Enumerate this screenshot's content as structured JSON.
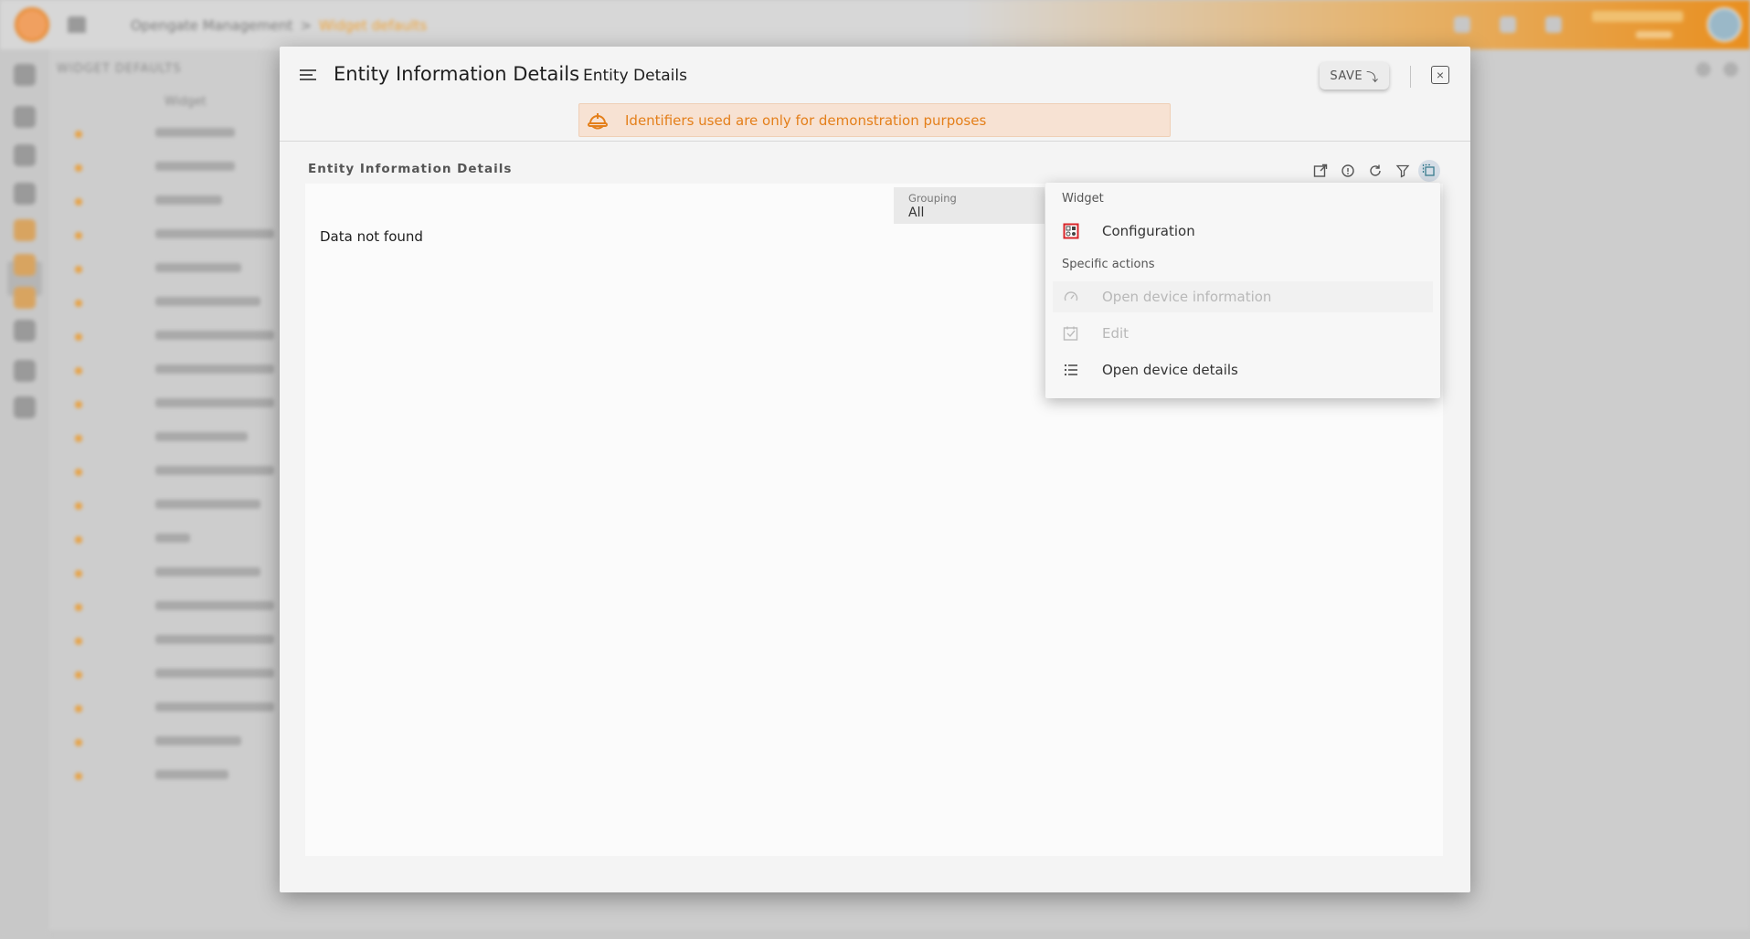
{
  "app": {
    "breadcrumb": {
      "parent": "Opengate Management",
      "separator": ">",
      "current": "Widget defaults"
    },
    "background_page_title": "WIDGET DEFAULTS",
    "background_column_header": "Widget",
    "background_rows": [
      "Alarms List",
      "Alarms Pies",
      "Bulk List",
      "Bulk List (advanced)",
      "Bundles List",
      "Datapoints List",
      "Datastream History",
      "Datastream Last Value",
      "Entities Alarms List",
      "Entities List",
      "Entity Information Details",
      "Executions List",
      "Maps",
      "Operations List",
      "Subscriber Information",
      "Subscription Information",
      "Ticket Datastream List",
      "Ticket Information Details",
      "Tickets list",
      "Users List"
    ]
  },
  "dialog": {
    "title": "Entity Information Details",
    "subtitle": "Entity Details",
    "save_label": "SAVE",
    "warning": "Identifiers used are only for demonstration purposes",
    "widget_title": "Entity Information Details",
    "grouping_label": "Grouping",
    "grouping_value": "All",
    "no_data": "Data not found"
  },
  "menu": {
    "section_widget": "Widget",
    "configuration": "Configuration",
    "section_specific": "Specific actions",
    "open_device_information": "Open device information",
    "edit": "Edit",
    "open_device_details": "Open device details"
  },
  "colors": {
    "accent_orange": "#e47f1a",
    "warning_bg": "#f7e2d3",
    "config_icon_red": "#d9252a"
  }
}
